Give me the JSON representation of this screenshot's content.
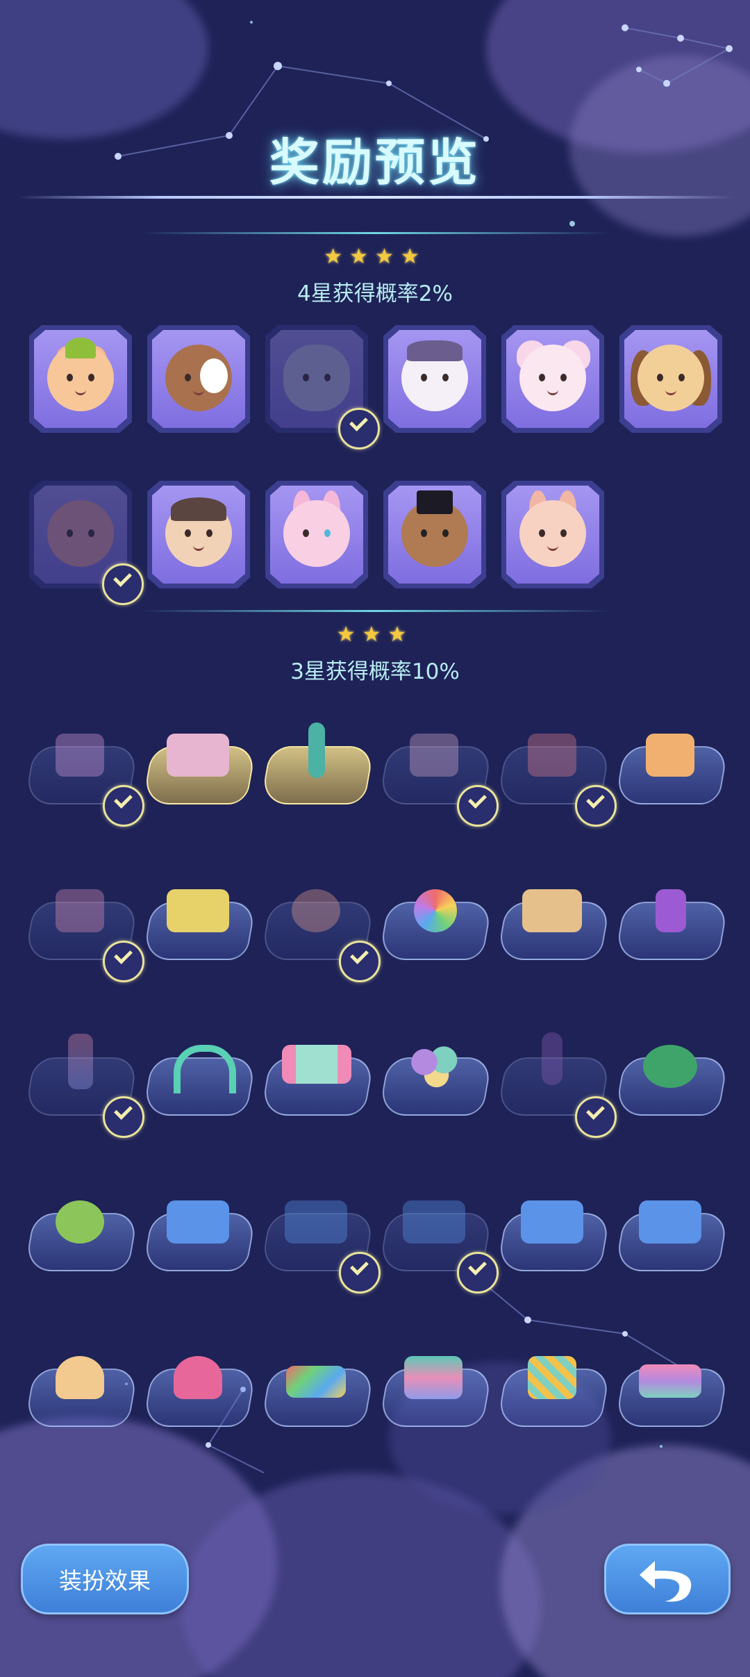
{
  "header": {
    "title": "奖励预览"
  },
  "tier4": {
    "stars": "★★★★",
    "probability": "4星获得概率2%"
  },
  "tier3": {
    "stars": "★★★",
    "probability": "3星获得概率10%"
  },
  "buttons": {
    "dress_effect": "装扮效果",
    "back_icon": "undo-arrow-icon"
  },
  "colors": {
    "background": "#1e2257",
    "title_glow": "#7be6ff",
    "star": "#f4c940",
    "check": "#e9e39a",
    "button": "#4a8fe2"
  }
}
